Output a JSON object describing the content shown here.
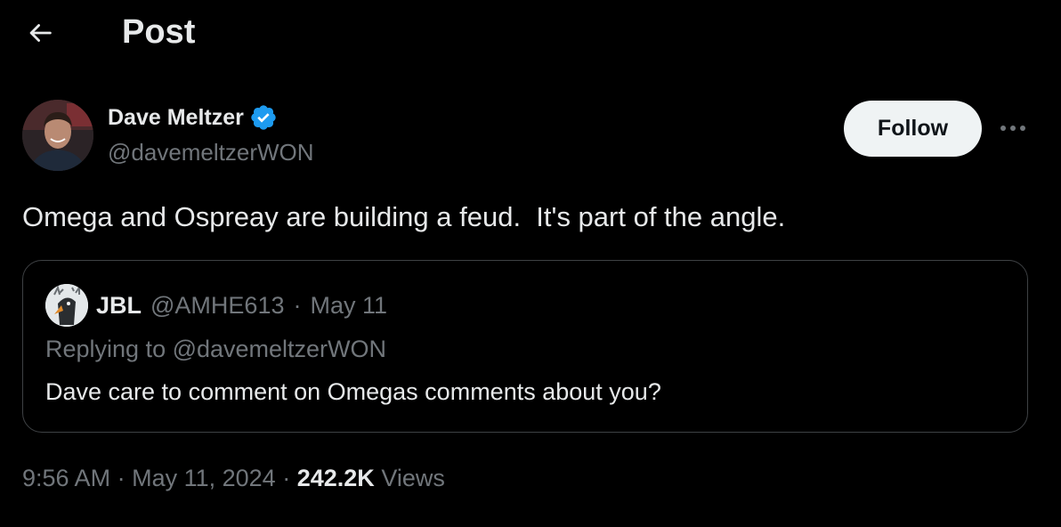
{
  "header": {
    "title": "Post"
  },
  "author": {
    "display_name": "Dave Meltzer",
    "handle": "@davemeltzerWON",
    "verified": true
  },
  "actions": {
    "follow_label": "Follow"
  },
  "post": {
    "text": "Omega and Ospreay are building a feud.  It's part of the angle."
  },
  "quoted_post": {
    "display_name": "JBL",
    "handle": "@AMHE613",
    "separator": "·",
    "date": "May 11",
    "replying_to": "Replying to @davemeltzerWON",
    "text": "Dave care to comment on Omegas comments about you?"
  },
  "meta": {
    "time": "9:56 AM",
    "separator": "·",
    "date": "May 11, 2024",
    "views_count": "242.2K",
    "views_label": "Views"
  },
  "colors": {
    "background": "#000000",
    "primary_text": "#e7e9ea",
    "secondary_text": "#71767b",
    "verified_badge": "#1d9bf0",
    "follow_button_bg": "#eff3f4",
    "border": "#3e4144"
  }
}
